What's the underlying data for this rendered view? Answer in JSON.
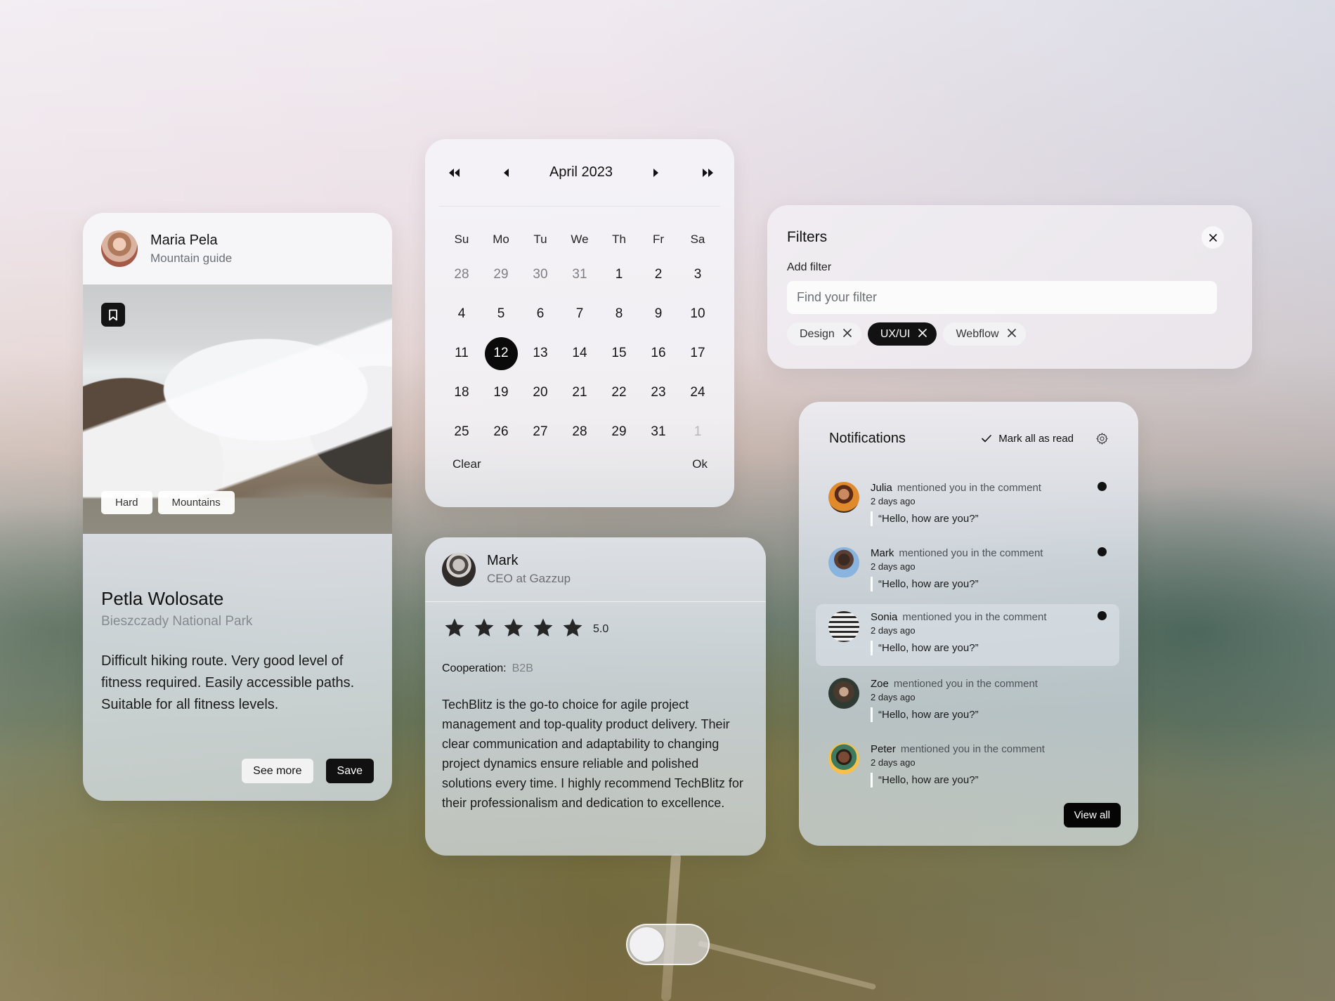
{
  "trail_card": {
    "author_name": "Maria Pela",
    "author_role": "Mountain guide",
    "tags": [
      "Hard",
      "Mountains"
    ],
    "title": "Petla Wolosate",
    "location": "Bieszczady National Park",
    "description": "Difficult hiking route. Very good level of fitness required. Easily accessible paths. Suitable for all fitness levels.",
    "see_more_label": "See more",
    "save_label": "Save"
  },
  "calendar": {
    "month_label": "April 2023",
    "weekdays": [
      "Su",
      "Mo",
      "Tu",
      "We",
      "Th",
      "Fr",
      "Sa"
    ],
    "days": [
      {
        "d": "28",
        "state": "muted"
      },
      {
        "d": "29",
        "state": "muted"
      },
      {
        "d": "30",
        "state": "muted"
      },
      {
        "d": "31",
        "state": "muted"
      },
      {
        "d": "1",
        "state": ""
      },
      {
        "d": "2",
        "state": ""
      },
      {
        "d": "3",
        "state": ""
      },
      {
        "d": "4",
        "state": ""
      },
      {
        "d": "5",
        "state": ""
      },
      {
        "d": "6",
        "state": ""
      },
      {
        "d": "7",
        "state": ""
      },
      {
        "d": "8",
        "state": ""
      },
      {
        "d": "9",
        "state": ""
      },
      {
        "d": "10",
        "state": ""
      },
      {
        "d": "11",
        "state": ""
      },
      {
        "d": "12",
        "state": "selected"
      },
      {
        "d": "13",
        "state": ""
      },
      {
        "d": "14",
        "state": ""
      },
      {
        "d": "15",
        "state": ""
      },
      {
        "d": "16",
        "state": ""
      },
      {
        "d": "17",
        "state": ""
      },
      {
        "d": "18",
        "state": ""
      },
      {
        "d": "19",
        "state": ""
      },
      {
        "d": "20",
        "state": ""
      },
      {
        "d": "21",
        "state": ""
      },
      {
        "d": "22",
        "state": ""
      },
      {
        "d": "23",
        "state": ""
      },
      {
        "d": "24",
        "state": ""
      },
      {
        "d": "25",
        "state": ""
      },
      {
        "d": "26",
        "state": ""
      },
      {
        "d": "27",
        "state": ""
      },
      {
        "d": "28",
        "state": ""
      },
      {
        "d": "29",
        "state": ""
      },
      {
        "d": "31",
        "state": ""
      },
      {
        "d": "1",
        "state": "faint"
      }
    ],
    "selected_day": "12",
    "clear_label": "Clear",
    "ok_label": "Ok"
  },
  "filters": {
    "title": "Filters",
    "add_filter_label": "Add filter",
    "search_placeholder": "Find your filter",
    "search_value": "",
    "chips": [
      {
        "label": "Design",
        "active": false
      },
      {
        "label": "UX/UI",
        "active": true
      },
      {
        "label": "Webflow",
        "active": false
      }
    ]
  },
  "review": {
    "author_name": "Mark",
    "author_role": "CEO at Gazzup",
    "rating": 5,
    "rating_max": 5,
    "rating_label": "5.0",
    "cooperation_label": "Cooperation:",
    "cooperation_value": "B2B",
    "text": "TechBlitz is the go-to choice for agile project management and top-quality product delivery. Their clear communication and adaptability to changing project dynamics ensure reliable and polished solutions every time. I highly recommend TechBlitz for their professionalism and dedication to excellence."
  },
  "notifications": {
    "title": "Notifications",
    "mark_all_label": "Mark all as read",
    "view_all_label": "View all",
    "items": [
      {
        "name": "Julia",
        "action": "mentioned you in the comment",
        "time": "2 days ago",
        "quote": "“Hello, how are you?”",
        "unread": true,
        "highlight": false
      },
      {
        "name": "Mark",
        "action": "mentioned you in the comment",
        "time": "2 days ago",
        "quote": "“Hello, how are you?”",
        "unread": true,
        "highlight": false
      },
      {
        "name": "Sonia",
        "action": "mentioned you in the comment",
        "time": "2 days ago",
        "quote": "“Hello, how are you?”",
        "unread": true,
        "highlight": true
      },
      {
        "name": "Zoe",
        "action": "mentioned you in the comment",
        "time": "2 days ago",
        "quote": "“Hello, how are you?”",
        "unread": false,
        "highlight": false
      },
      {
        "name": "Peter",
        "action": "mentioned you in the comment",
        "time": "2 days ago",
        "quote": "“Hello, how are you?”",
        "unread": false,
        "highlight": false
      }
    ]
  },
  "toggle": {
    "on": false
  },
  "colors": {
    "accent_dark": "#111111",
    "unread_dot": "#121212",
    "muted_text": "#6b6f75"
  }
}
